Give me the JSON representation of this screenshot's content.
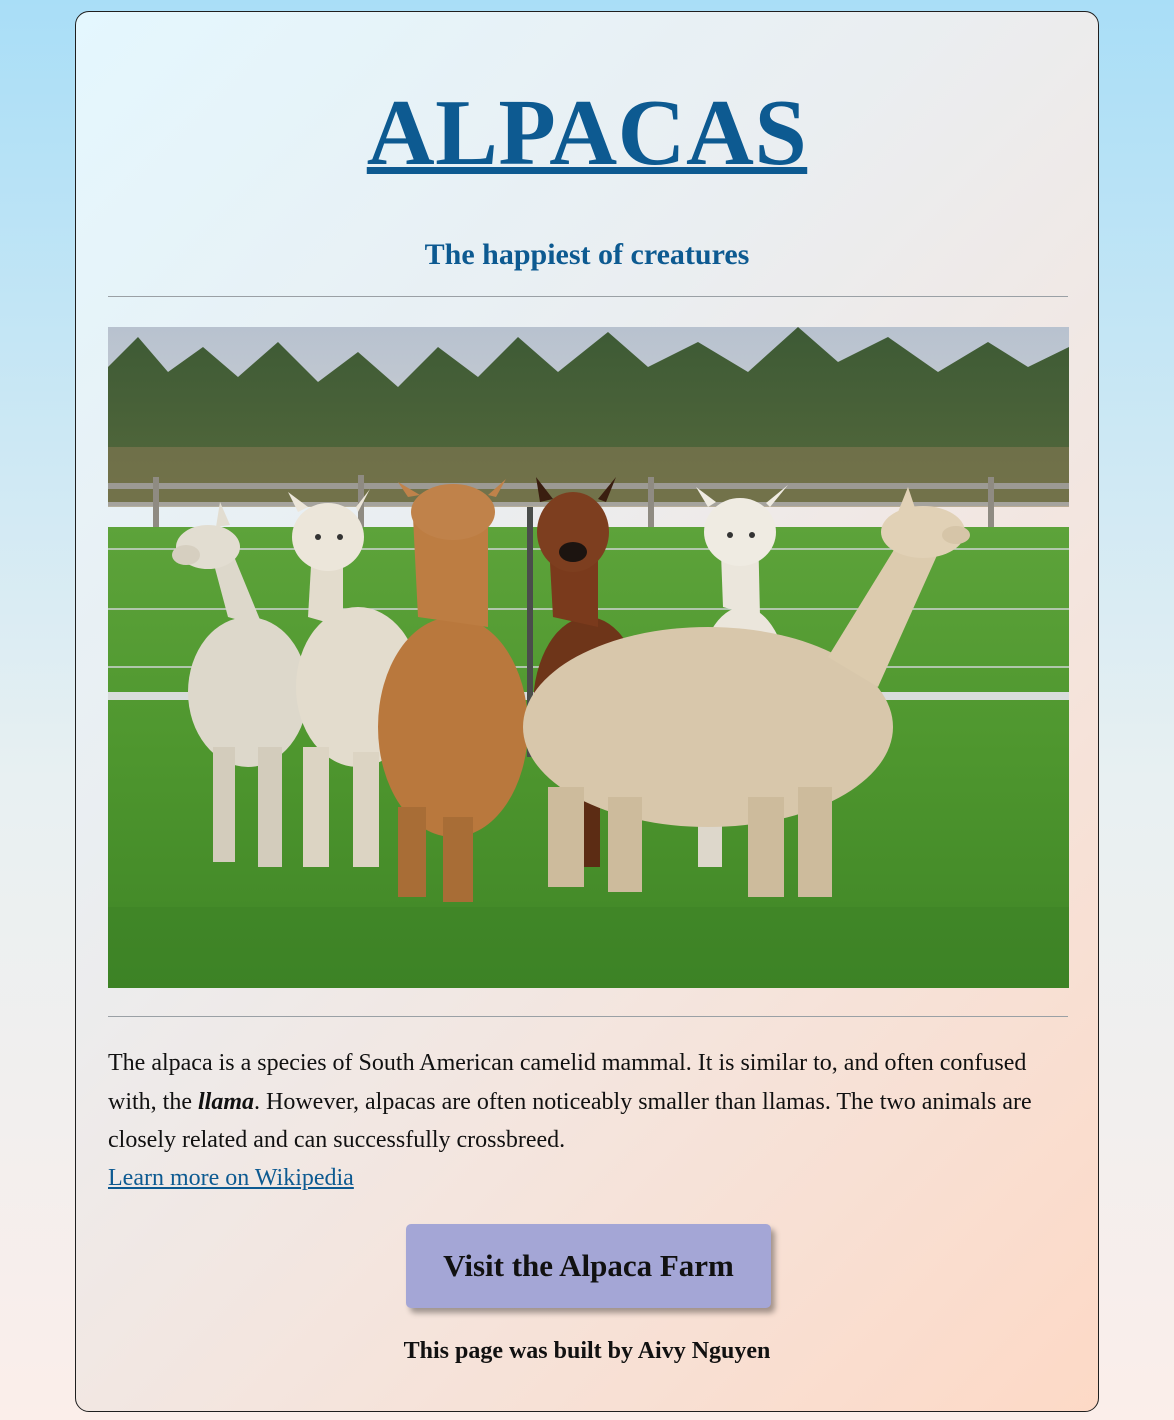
{
  "header": {
    "title": "ALPACAS",
    "subtitle": "The happiest of creatures"
  },
  "image": {
    "alt": "A group of alpacas standing in a green pasture"
  },
  "description": {
    "text_before": "The alpaca is a species of South American camelid mammal. It is similar to, and often confused with, the ",
    "emphasis": "llama",
    "text_after": ". However, alpacas are often noticeably smaller than llamas. The two animals are closely related and can successfully crossbreed."
  },
  "link": {
    "label": "Learn more on Wikipedia"
  },
  "cta": {
    "label": "Visit the Alpaca Farm"
  },
  "footer": {
    "text": "This page was built by Aivy Nguyen"
  },
  "colors": {
    "accent": "#0d5a91",
    "button": "#a4a6d6"
  }
}
